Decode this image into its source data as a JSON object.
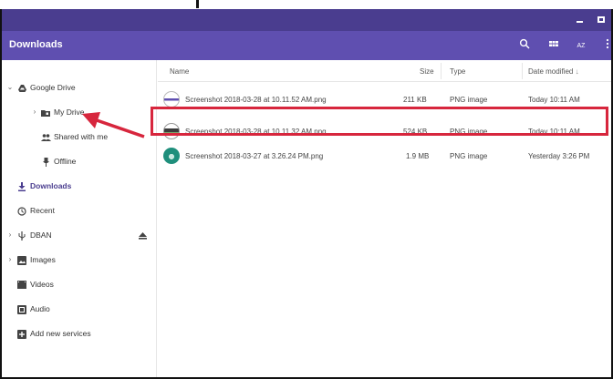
{
  "app": {
    "title": "Downloads"
  },
  "toolbar": {
    "search_icon": "search-icon",
    "grid_icon": "grid-view-icon",
    "sort_icon_text": "AZ",
    "more_icon": "more-vert-icon"
  },
  "sidebar": {
    "items": [
      {
        "label": "Google Drive"
      },
      {
        "label": "My Drive"
      },
      {
        "label": "Shared with me"
      },
      {
        "label": "Offline"
      },
      {
        "label": "Downloads"
      },
      {
        "label": "Recent"
      },
      {
        "label": "DBAN"
      },
      {
        "label": "Images"
      },
      {
        "label": "Videos"
      },
      {
        "label": "Audio"
      },
      {
        "label": "Add new services"
      }
    ]
  },
  "table": {
    "headers": {
      "name": "Name",
      "size": "Size",
      "type": "Type",
      "date": "Date modified"
    },
    "rows": [
      {
        "name": "Screenshot 2018-03-28 at 10.11.52 AM.png",
        "size": "211 KB",
        "type": "PNG image",
        "date": "Today 10:11 AM"
      },
      {
        "name": "Screenshot 2018-03-28 at 10.11.32 AM.png",
        "size": "524 KB",
        "type": "PNG image",
        "date": "Today 10:11 AM"
      },
      {
        "name": "Screenshot 2018-03-27 at 3.26.24 PM.png",
        "size": "1.9 MB",
        "type": "PNG image",
        "date": "Yesterday 3:26 PM"
      }
    ]
  },
  "colors": {
    "titlebar": "#4a3d8f",
    "appbar": "#5f4fb0",
    "accent": "#4a3d8f",
    "annotation": "#d7263d"
  }
}
